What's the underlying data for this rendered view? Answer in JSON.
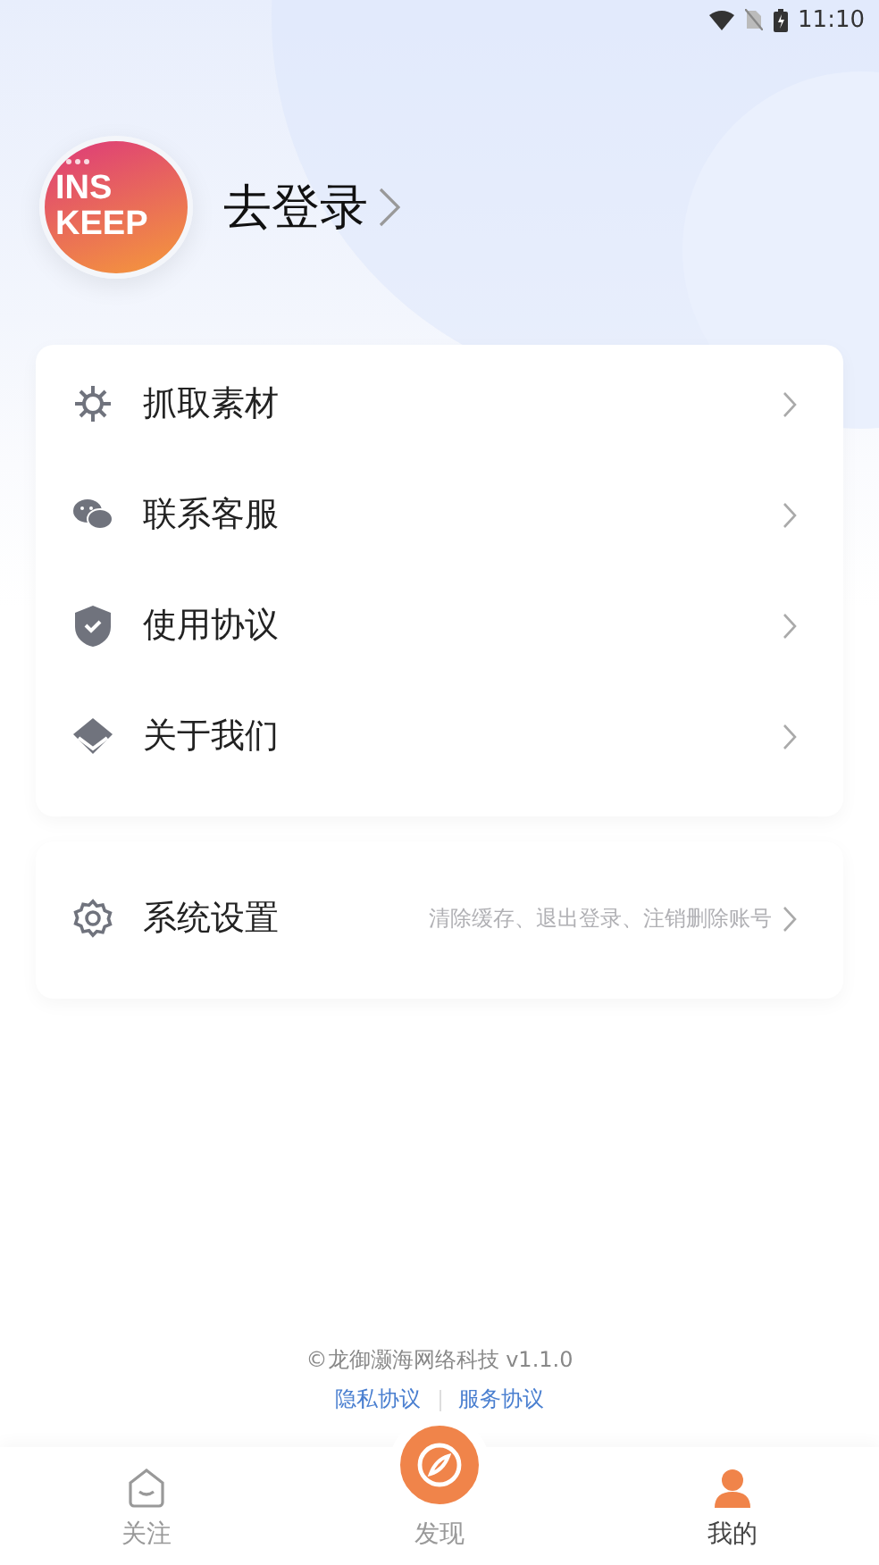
{
  "status_bar": {
    "time": "11:10"
  },
  "profile": {
    "logo_lines": [
      "INS",
      "KEEP"
    ],
    "login": "去登录"
  },
  "menu": [
    {
      "kind": "material",
      "label": "抓取素材"
    },
    {
      "kind": "chat",
      "label": "联系客服"
    },
    {
      "kind": "shield",
      "label": "使用协议"
    },
    {
      "kind": "diamond",
      "label": "关于我们"
    }
  ],
  "settings": {
    "label": "系统设置",
    "hint": "清除缓存、退出登录、注销删除账号"
  },
  "footer": {
    "copyright": "©龙御灏海网络科技 v1.1.0",
    "links": [
      "隐私协议",
      "服务协议"
    ]
  },
  "tabs": [
    {
      "kind": "home",
      "label": "关注",
      "selected": false
    },
    {
      "kind": "center",
      "label": "发现",
      "selected": false
    },
    {
      "kind": "user",
      "label": "我的",
      "selected": true
    }
  ]
}
